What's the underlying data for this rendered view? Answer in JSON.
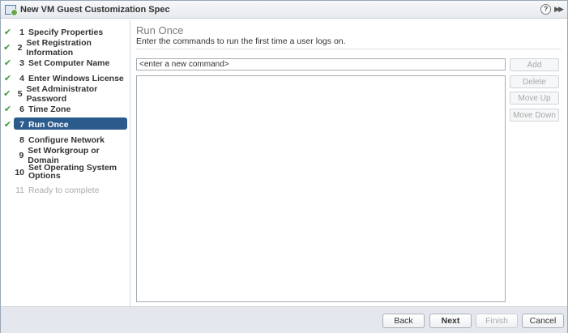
{
  "window": {
    "title": "New VM Guest Customization Spec"
  },
  "steps": [
    {
      "num": "1",
      "label": "Specify Properties",
      "done": true
    },
    {
      "num": "2",
      "label": "Set Registration Information",
      "done": true
    },
    {
      "num": "3",
      "label": "Set Computer Name",
      "done": true
    },
    {
      "num": "4",
      "label": "Enter Windows License",
      "done": true
    },
    {
      "num": "5",
      "label": "Set Administrator Password",
      "done": true
    },
    {
      "num": "6",
      "label": "Time Zone",
      "done": true
    },
    {
      "num": "7",
      "label": "Run Once",
      "done": true
    },
    {
      "num": "8",
      "label": "Configure Network",
      "done": false
    },
    {
      "num": "9",
      "label": "Set Workgroup or Domain",
      "done": false
    },
    {
      "num": "10",
      "label": "Set Operating System Options",
      "done": false
    },
    {
      "num": "11",
      "label": "Ready to complete",
      "done": false
    }
  ],
  "main": {
    "title": "Run Once",
    "description": "Enter the commands to run the first time a user logs on.",
    "command_input": {
      "value": "<enter a new command>"
    },
    "buttons": {
      "add": "Add",
      "delete": "Delete",
      "move_up": "Move Up",
      "move_down": "Move Down"
    }
  },
  "footer": {
    "back": "Back",
    "next": "Next",
    "finish": "Finish",
    "cancel": "Cancel"
  },
  "icons": {
    "title": "customization-spec-icon",
    "help": "help-icon",
    "expand": "double-chevron-right-icon",
    "check": "checkmark-icon"
  },
  "colors": {
    "active_step": "#2b5a8c",
    "check": "#3a9a3a"
  }
}
